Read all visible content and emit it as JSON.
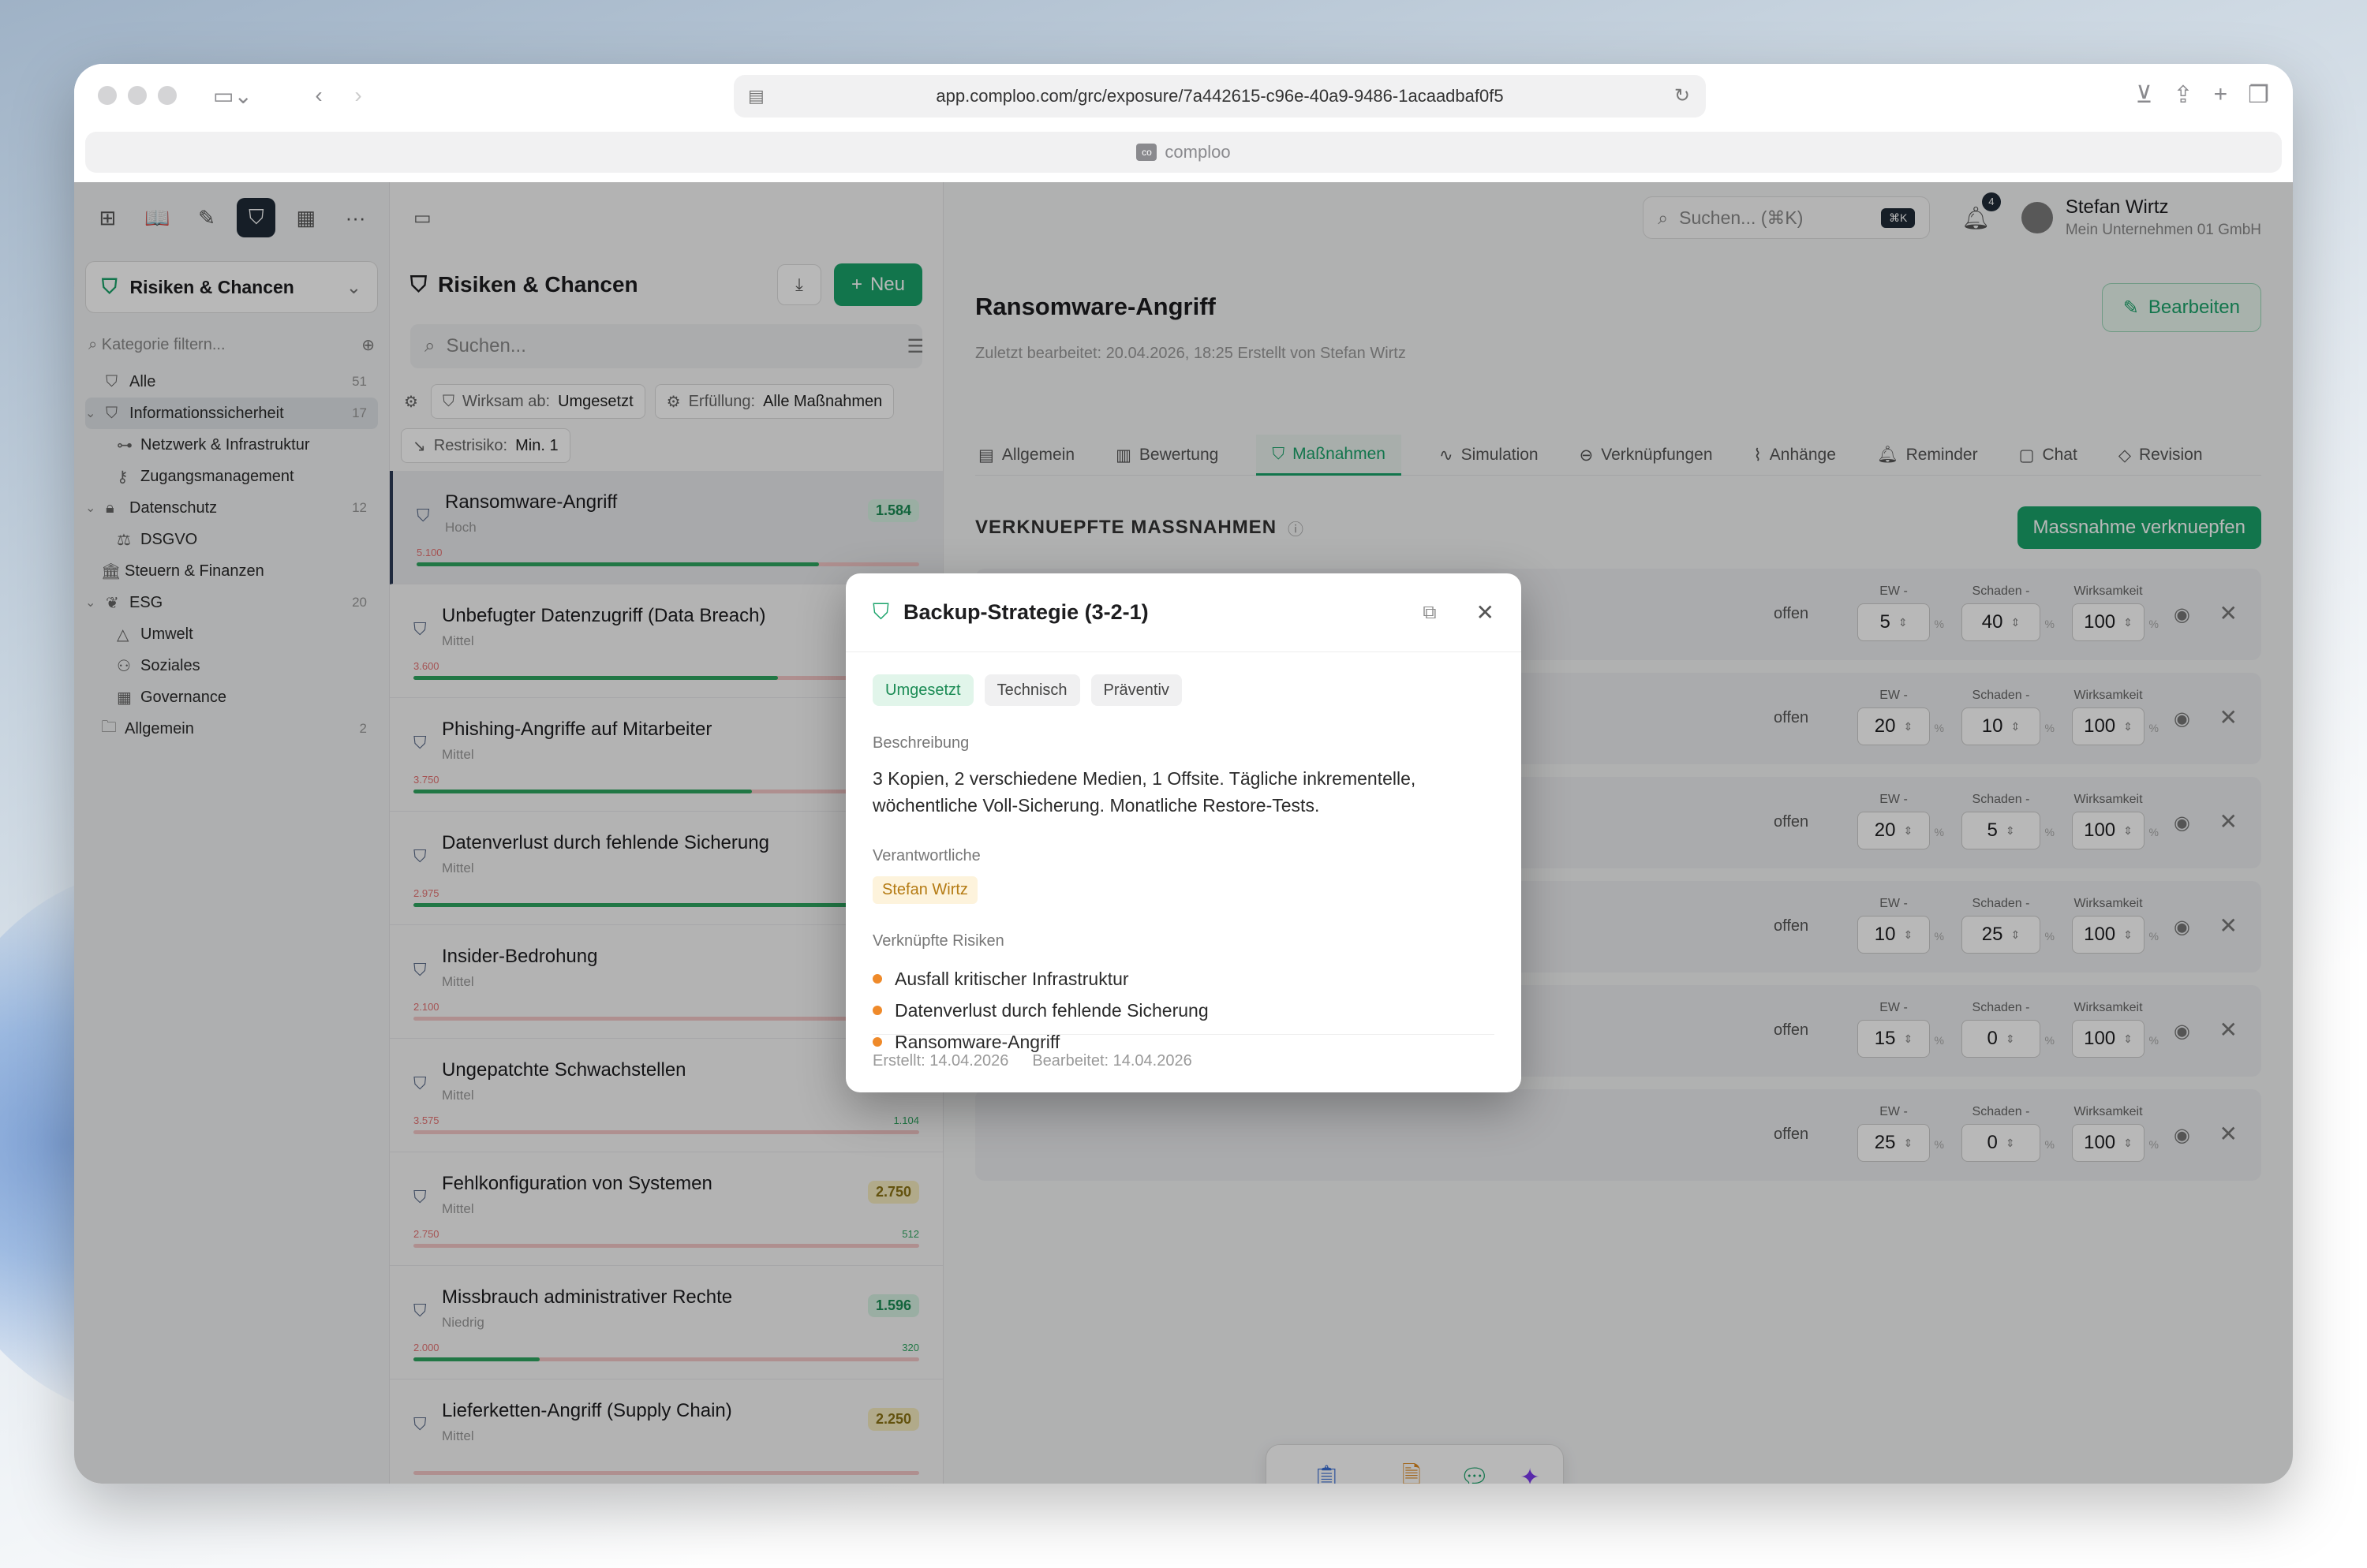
{
  "browser": {
    "url": "app.comploo.com/grc/exposure/7a442615-c96e-40a9-9486-1acaadbaf0f5",
    "tab_title": "comploo",
    "tab_favicon": "co"
  },
  "sidebar": {
    "module": "Risiken & Chancen",
    "filter_placeholder": "Kategorie filtern...",
    "items": [
      {
        "label": "Alle",
        "count": "51"
      },
      {
        "label": "Informationssicherheit",
        "count": "17"
      },
      {
        "label": "Netzwerk & Infrastruktur",
        "count": ""
      },
      {
        "label": "Zugangsmanagement",
        "count": ""
      },
      {
        "label": "Datenschutz",
        "count": "12"
      },
      {
        "label": "DSGVO",
        "count": ""
      },
      {
        "label": "Steuern & Finanzen",
        "count": ""
      },
      {
        "label": "ESG",
        "count": "20"
      },
      {
        "label": "Umwelt",
        "count": ""
      },
      {
        "label": "Soziales",
        "count": ""
      },
      {
        "label": "Governance",
        "count": ""
      },
      {
        "label": "Allgemein",
        "count": "2"
      }
    ]
  },
  "list": {
    "title": "Risiken & Chancen",
    "new_label": "Neu",
    "search_placeholder": "Suchen...",
    "filters": {
      "wirksam_label": "Wirksam ab:",
      "wirksam_value": "Umgesetzt",
      "erfuellung_label": "Erfüllung:",
      "erfuellung_value": "Alle Maßnahmen",
      "restrisiko_label": "Restrisiko:",
      "restrisiko_value": "Min. 1"
    },
    "risks": [
      {
        "name": "Ransomware-Angriff",
        "level": "Hoch",
        "score": "1.584",
        "color": "green",
        "left": "5.100",
        "right": "",
        "fill": 0.8
      },
      {
        "name": "Unbefugter Datenzugriff (Data Breach)",
        "level": "Mittel",
        "score": "",
        "color": "green",
        "left": "3.600",
        "right": "",
        "fill": 0.72
      },
      {
        "name": "Phishing-Angriffe auf Mitarbeiter",
        "level": "Mittel",
        "score": "",
        "color": "green",
        "left": "3.750",
        "right": "",
        "fill": 0.67
      },
      {
        "name": "Datenverlust durch fehlende Sicherung",
        "level": "Mittel",
        "score": "",
        "color": "green",
        "left": "2.975",
        "right": "",
        "fill": 0.9
      },
      {
        "name": "Insider-Bedrohung",
        "level": "Mittel",
        "score": "",
        "color": "green",
        "left": "2.100",
        "right": "",
        "fill": 0
      },
      {
        "name": "Ungepatchte Schwachstellen",
        "level": "Mittel",
        "score": "3.575",
        "color": "yellow",
        "left": "3.575",
        "right": "1.104",
        "fill": 0
      },
      {
        "name": "Fehlkonfiguration von Systemen",
        "level": "Mittel",
        "score": "2.750",
        "color": "yellow",
        "left": "2.750",
        "right": "512",
        "fill": 0
      },
      {
        "name": "Missbrauch administrativer Rechte",
        "level": "Niedrig",
        "score": "1.596",
        "color": "green",
        "left": "2.000",
        "right": "320",
        "fill": 0.25
      },
      {
        "name": "Lieferketten-Angriff (Supply Chain)",
        "level": "Mittel",
        "score": "2.250",
        "color": "yellow",
        "left": "",
        "right": "",
        "fill": 0
      }
    ]
  },
  "header": {
    "search_placeholder": "Suchen... (⌘K)",
    "kbd": "⌘K",
    "notifications": "4",
    "user_name": "Stefan Wirtz",
    "company": "Mein Unternehmen 01 GmbH"
  },
  "detail": {
    "title": "Ransomware-Angriff",
    "meta": "Zuletzt bearbeitet: 20.04.2026, 18:25   Erstellt von Stefan Wirtz",
    "edit_label": "Bearbeiten",
    "tabs": [
      "Allgemein",
      "Bewertung",
      "Maßnahmen",
      "Simulation",
      "Verknüpfungen",
      "Anhänge",
      "Reminder",
      "Chat",
      "Revision"
    ],
    "section_title": "VERKNUEPFTE MASSNAHMEN",
    "link_button": "Massnahme verknuepfen",
    "col_ew": "EW -",
    "col_schaden": "Schaden -",
    "col_wirksamkeit": "Wirksamkeit",
    "measures": [
      {
        "name": "Backup-Strategie (3-2-1)",
        "status": "offen",
        "ew": "5",
        "schaden": "40",
        "wirksamkeit": "100"
      },
      {
        "name": "",
        "status": "offen",
        "ew": "20",
        "schaden": "10",
        "wirksamkeit": "100"
      },
      {
        "name": "",
        "status": "offen",
        "ew": "20",
        "schaden": "5",
        "wirksamkeit": "100"
      },
      {
        "name": "",
        "status": "offen",
        "ew": "10",
        "schaden": "25",
        "wirksamkeit": "100"
      },
      {
        "name": "",
        "status": "offen",
        "ew": "15",
        "schaden": "0",
        "wirksamkeit": "100"
      },
      {
        "name": "",
        "status": "offen",
        "ew": "25",
        "schaden": "0",
        "wirksamkeit": "100"
      }
    ]
  },
  "dock": [
    {
      "label": "Zwischenablage",
      "icon": "clipboard-icon",
      "color": "#3b6fd6"
    },
    {
      "label": "Notizen",
      "icon": "notes-icon",
      "color": "#e08a1e"
    },
    {
      "label": "Chat",
      "icon": "chat-icon",
      "color": "#1aa36a"
    },
    {
      "label": "KI",
      "icon": "sparkle-icon",
      "color": "#7c3aed"
    }
  ],
  "popup": {
    "title": "Backup-Strategie (3-2-1)",
    "tags": [
      "Umgesetzt",
      "Technisch",
      "Präventiv"
    ],
    "desc_label": "Beschreibung",
    "description": "3 Kopien, 2 verschiedene Medien, 1 Offsite. Tägliche inkrementelle, wöchentliche Voll-Sicherung. Monatliche Restore-Tests.",
    "owner_label": "Verantwortliche",
    "owner": "Stefan Wirtz",
    "risks_label": "Verknüpfte Risiken",
    "linked_risks": [
      "Ausfall kritischer Infrastruktur",
      "Datenverlust durch fehlende Sicherung",
      "Ransomware-Angriff"
    ],
    "created": "Erstellt: 14.04.2026",
    "edited": "Bearbeitet: 14.04.2026"
  }
}
